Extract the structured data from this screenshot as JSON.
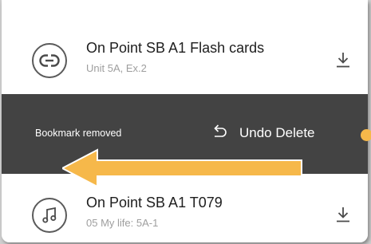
{
  "items": [
    {
      "title": "On Point SB A1 Flash cards",
      "subtitle": "Unit 5A, Ex.2",
      "icon": "link-icon"
    },
    {
      "title": "On Point SB A1 T079",
      "subtitle": "05 My life: 5A-1",
      "icon": "music-note-icon"
    }
  ],
  "snackbar": {
    "message": "Bookmark removed",
    "action_label": "Undo Delete"
  },
  "colors": {
    "snackbar_bg": "#434343",
    "accent_arrow": "#f6b84a"
  }
}
